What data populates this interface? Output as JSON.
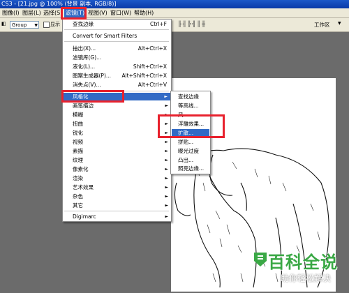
{
  "title_bar": {
    "text": "CS3 - [21.jpg @ 100% (背景 副本, RGB/8)]"
  },
  "menubar": {
    "items": [
      "图像(I)",
      "图层(L)",
      "选择(S)",
      "滤镜(T)",
      "视图(V)",
      "窗口(W)",
      "帮助(H)"
    ]
  },
  "options_bar": {
    "group_value": "Group",
    "show_label": "显示",
    "workspace_label": "工作区"
  },
  "filter_menu": {
    "items": [
      {
        "label": "查找边缘",
        "shortcut": "Ctrl+F"
      },
      {
        "label": "Convert for Smart Filters",
        "shortcut": ""
      },
      {
        "label": "抽出(X)...",
        "shortcut": "Alt+Ctrl+X"
      },
      {
        "label": "滤镜库(G)...",
        "shortcut": ""
      },
      {
        "label": "液化(L)...",
        "shortcut": "Shift+Ctrl+X"
      },
      {
        "label": "图案生成器(P)...",
        "shortcut": "Alt+Shift+Ctrl+X"
      },
      {
        "label": "消失点(V)...",
        "shortcut": "Alt+Ctrl+V"
      },
      {
        "label": "风格化",
        "shortcut": ""
      },
      {
        "label": "画笔描边",
        "shortcut": ""
      },
      {
        "label": "模糊",
        "shortcut": ""
      },
      {
        "label": "扭曲",
        "shortcut": ""
      },
      {
        "label": "锐化",
        "shortcut": ""
      },
      {
        "label": "视频",
        "shortcut": ""
      },
      {
        "label": "素描",
        "shortcut": ""
      },
      {
        "label": "纹理",
        "shortcut": ""
      },
      {
        "label": "像素化",
        "shortcut": ""
      },
      {
        "label": "渲染",
        "shortcut": ""
      },
      {
        "label": "艺术效果",
        "shortcut": ""
      },
      {
        "label": "杂色",
        "shortcut": ""
      },
      {
        "label": "其它",
        "shortcut": ""
      },
      {
        "label": "Digimarc",
        "shortcut": ""
      }
    ]
  },
  "stylize_submenu": {
    "items": [
      "查找边缘",
      "等高线...",
      "风",
      "浮雕效果...",
      "扩散...",
      "拼贴...",
      "曝光过度",
      "凸出...",
      "照亮边缘..."
    ]
  },
  "watermark": {
    "main": "百科全说",
    "sub": "助你轻松解决"
  },
  "colors": {
    "highlight": "#316ac5",
    "annotation_red": "#e8212d",
    "watermark_green": "#3aa845"
  }
}
